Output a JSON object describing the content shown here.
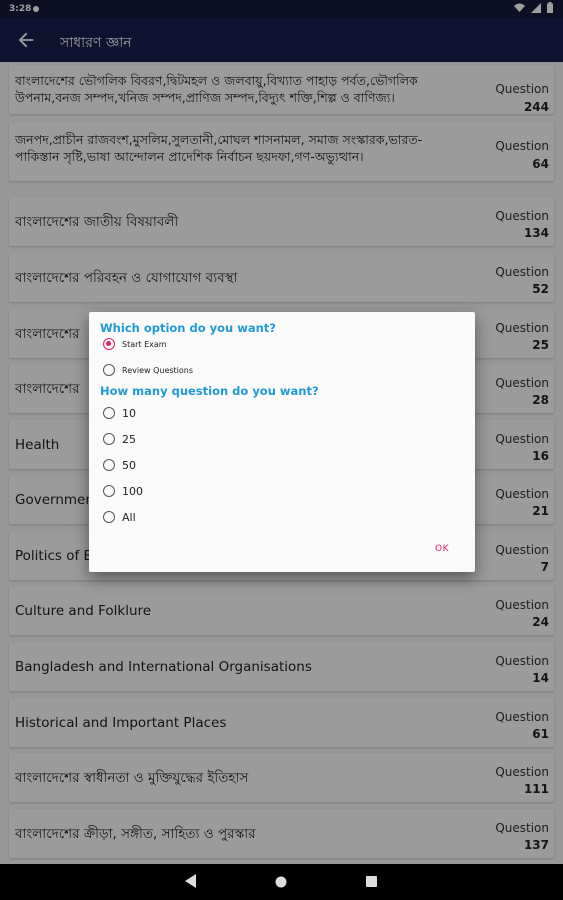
{
  "status": {
    "time": "3:28"
  },
  "appbar": {
    "title": "সাধারণ জ্ঞান"
  },
  "rows": [
    {
      "label": "বাংলাদেশের ভৌগলিক বিবরণ,দ্বিটমহল ও জলবায়ু,বিখ্যাত পাহাড় পর্বত,ভৌগলিক উপনাম,বনজ সম্পদ,খনিজ সম্পদ,প্রাণিজ সম্পদ,বিদ্যুৎ শক্তি,শিল্প ও বাণিজ্য।",
      "qlabel": "Question",
      "count": "244"
    },
    {
      "label": "জনপদ,প্রাচীন রাজবংশ,মুসলিম,সুলতানী,মোঘল শাসনামল, সমাজ সংস্কারক,ভারত-পাকিস্তান সৃষ্টি,ভাষা আন্দোলন প্রাদেশিক নির্বাচন ছয়দফা,গণ-অভ্যুত্থান।",
      "qlabel": "Question",
      "count": "64"
    },
    {
      "label": "বাংলাদেশের জাতীয় বিষয়াবলী",
      "qlabel": "Question",
      "count": "134"
    },
    {
      "label": "বাংলাদেশের পরিবহন ও যোগাযোগ ব্যবস্থা",
      "qlabel": "Question",
      "count": "52"
    },
    {
      "label": "বাংলাদেশের",
      "qlabel": "Question",
      "count": "25"
    },
    {
      "label": "বাংলাদেশের",
      "qlabel": "Question",
      "count": "28"
    },
    {
      "label": "Health",
      "qlabel": "Question",
      "count": "16"
    },
    {
      "label": "Government",
      "qlabel": "Question",
      "count": "21"
    },
    {
      "label": "Politics of B",
      "qlabel": "Question",
      "count": "7"
    },
    {
      "label": "Culture and Folklure",
      "qlabel": "Question",
      "count": "24"
    },
    {
      "label": "Bangladesh and International Organisations",
      "qlabel": "Question",
      "count": "14"
    },
    {
      "label": "Historical and Important Places",
      "qlabel": "Question",
      "count": "61"
    },
    {
      "label": "বাংলাদেশের স্বাধীনতা ও মুক্তিযুদ্ধের ইতিহাস",
      "qlabel": "Question",
      "count": "111"
    },
    {
      "label": "বাংলাদেশের ক্রীড়া, সঙ্গীত, সাহিত্য ও পুরস্কার",
      "qlabel": "Question",
      "count": "137"
    }
  ],
  "dialog": {
    "heading1": "Which option do you want?",
    "mode_options": [
      "Start Exam",
      "Review Questions"
    ],
    "heading2": "How many question do you want?",
    "count_options": [
      "10",
      "25",
      "50",
      "100",
      "All"
    ],
    "ok": "OK",
    "selected_mode": "Start Exam"
  },
  "colors": {
    "appbar": "#1b1f4e",
    "accent": "#e91e63",
    "heading": "#1f9ad6"
  }
}
